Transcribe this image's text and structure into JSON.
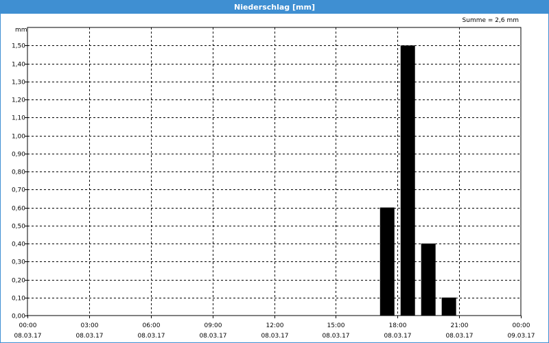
{
  "window": {
    "title": "Niederschlag [mm]"
  },
  "chart_data": {
    "type": "bar",
    "title": "Niederschlag [mm]",
    "annotation": "Summe = 2,6 mm",
    "ylabel": "mm",
    "xlabel": "",
    "ylim": [
      0,
      1.6
    ],
    "yticks": [
      0,
      0.1,
      0.2,
      0.3,
      0.4,
      0.5,
      0.6,
      0.7,
      0.8,
      0.9,
      1.0,
      1.1,
      1.2,
      1.3,
      1.4,
      1.5
    ],
    "ytick_labels": [
      "0,00",
      "0,10",
      "0,20",
      "0,30",
      "0,40",
      "0,50",
      "0,60",
      "0,70",
      "0,80",
      "0,90",
      "1,00",
      "1,10",
      "1,20",
      "1,30",
      "1,40",
      "1,50"
    ],
    "xlim_hours": [
      0,
      24
    ],
    "xticks_hours": [
      0,
      3,
      6,
      9,
      12,
      15,
      18,
      21,
      24
    ],
    "xtick_time_labels": [
      "00:00",
      "03:00",
      "06:00",
      "09:00",
      "12:00",
      "15:00",
      "18:00",
      "21:00",
      "00:00"
    ],
    "xtick_date_labels": [
      "08.03.17",
      "08.03.17",
      "08.03.17",
      "08.03.17",
      "08.03.17",
      "08.03.17",
      "08.03.17",
      "08.03.17",
      "09.03.17"
    ],
    "grid": true,
    "series": [
      {
        "color": "#000000",
        "points": [
          {
            "start_hour": 17,
            "end_hour": 18,
            "value": 0.6
          },
          {
            "start_hour": 18,
            "end_hour": 19,
            "value": 1.5
          },
          {
            "start_hour": 19,
            "end_hour": 20,
            "value": 0.4
          },
          {
            "start_hour": 20,
            "end_hour": 21,
            "value": 0.1
          }
        ]
      }
    ]
  }
}
